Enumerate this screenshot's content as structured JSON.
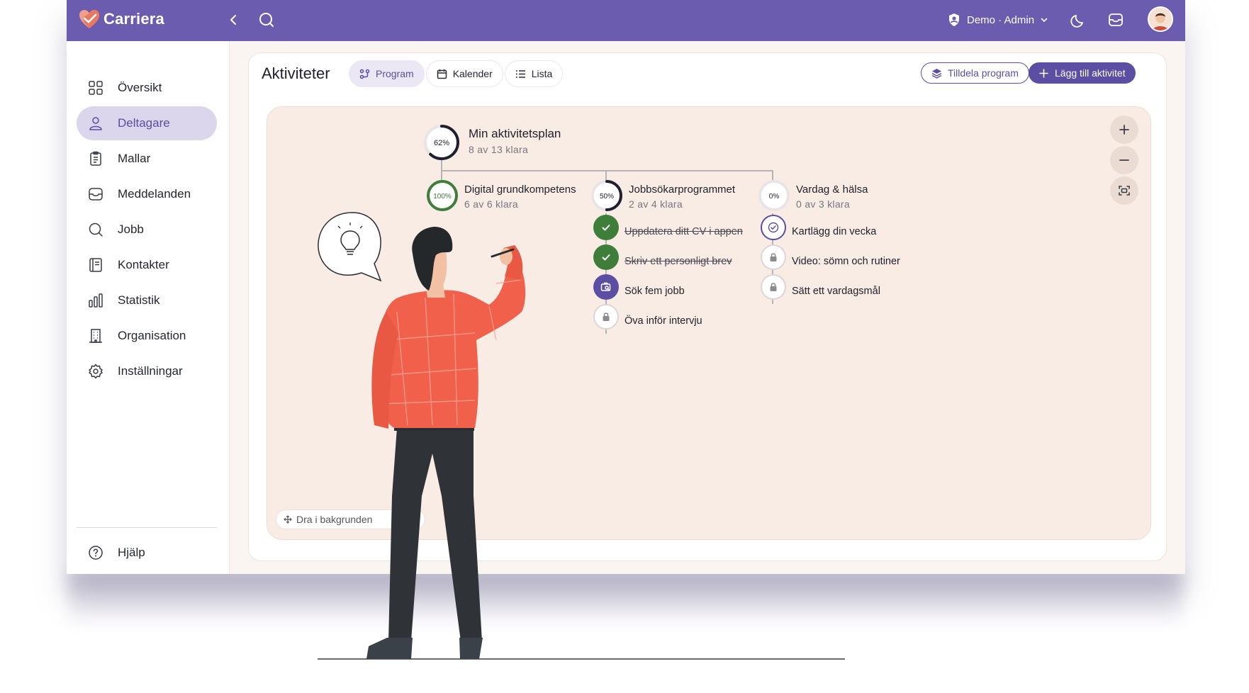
{
  "app": {
    "name": "Carriera"
  },
  "user": {
    "label": "Demo · Admin"
  },
  "sidebar": {
    "items": [
      {
        "label": "Översikt",
        "icon": "grid-icon"
      },
      {
        "label": "Deltagare",
        "icon": "user-icon",
        "active": true
      },
      {
        "label": "Mallar",
        "icon": "clipboard-icon"
      },
      {
        "label": "Meddelanden",
        "icon": "inbox-icon"
      },
      {
        "label": "Jobb",
        "icon": "search-icon"
      },
      {
        "label": "Kontakter",
        "icon": "contacts-book-icon"
      },
      {
        "label": "Statistik",
        "icon": "bar-chart-icon"
      },
      {
        "label": "Organisation",
        "icon": "building-icon"
      },
      {
        "label": "Inställningar",
        "icon": "gear-icon"
      }
    ],
    "help": {
      "label": "Hjälp",
      "icon": "help-circle-icon"
    }
  },
  "page": {
    "title": "Aktiviteter",
    "tabs": [
      {
        "label": "Program",
        "icon": "program-icon",
        "active": true
      },
      {
        "label": "Kalender",
        "icon": "calendar-icon"
      },
      {
        "label": "Lista",
        "icon": "list-icon"
      }
    ],
    "assign_button": "Tilldela program",
    "add_button": "Lägg till aktivitet",
    "hint": "Dra i bakgrunden",
    "hint_tail": "pan"
  },
  "plan": {
    "title": "Min aktivitetsplan",
    "percent_label": "62%",
    "progress": 0.62,
    "sub": "8 av 13 klara",
    "programs": [
      {
        "title": "Digital grundkompetens",
        "percent_label": "100%",
        "progress": 1.0,
        "sub": "6 av 6 klara",
        "tasks": []
      },
      {
        "title": "Jobbsökarprogrammet",
        "percent_label": "50%",
        "progress": 0.5,
        "sub": "2 av 4 klara",
        "tasks": [
          {
            "label": "Uppdatera ditt CV i appen",
            "status": "done"
          },
          {
            "label": "Skriv ett personligt brev",
            "status": "done"
          },
          {
            "label": "Sök fem jobb",
            "status": "current"
          },
          {
            "label": "Öva inför intervju",
            "status": "locked"
          }
        ]
      },
      {
        "title": "Vardag & hälsa",
        "percent_label": "0%",
        "progress": 0,
        "sub": "0 av 3 klara",
        "tasks": [
          {
            "label": "Kartlägg din vecka",
            "status": "available"
          },
          {
            "label": "Video: sömn och rutiner",
            "status": "locked"
          },
          {
            "label": "Sätt ett vardagsmål",
            "status": "locked"
          }
        ]
      }
    ]
  },
  "colors": {
    "brand": "#6b5cb0",
    "accent": "#5b4ea3",
    "done": "#3f7d3a",
    "canvas": "#f8ece4",
    "illustration_shirt": "#f0604b"
  }
}
